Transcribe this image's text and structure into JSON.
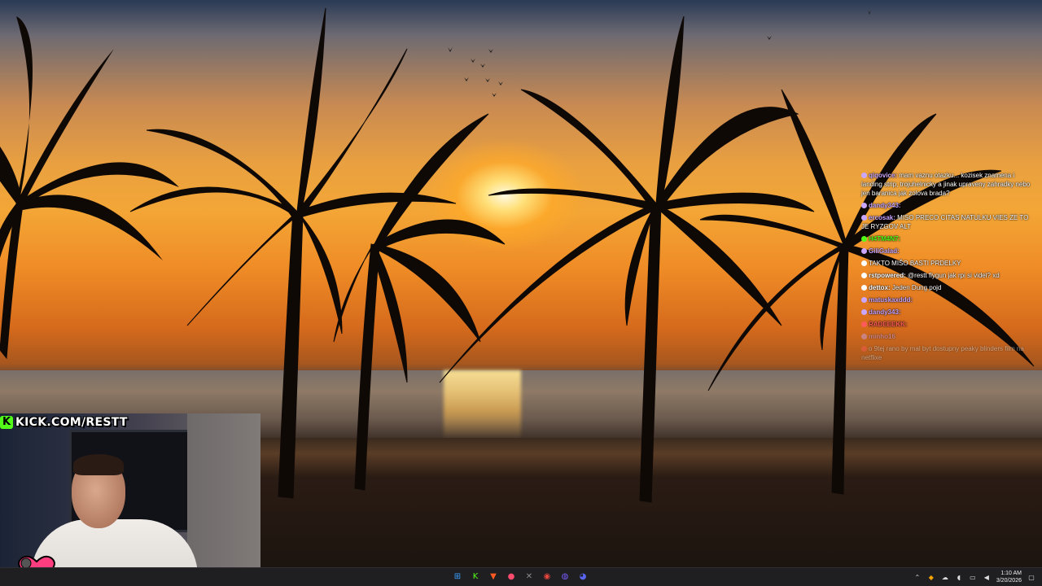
{
  "overlay": {
    "stream_url": "KICK.COM/RESTT",
    "kick_logo_letter": "K"
  },
  "chat": {
    "messages": [
      {
        "user": "qiqovice:",
        "text": "mam vaznu otazku... kozisek znamena i landing strip, trojuhelnicky a jinak upraveny zahradky nebo jen baranica jak zolova brada?",
        "user_color": "#c9a6ff",
        "dim": false
      },
      {
        "user": "dandy343:",
        "text": "",
        "user_color": "#c9a6ff",
        "dim": false
      },
      {
        "user": "ercosak:",
        "text": "MISO PRECO CITAS NATULKU VIES ZE TO JE RYZGOV ALT",
        "user_color": "#c9a6ff",
        "dim": false
      },
      {
        "user": "H4TM4N7:",
        "text": "",
        "user_color": "#53fc18",
        "dim": false
      },
      {
        "user": "GiliGalad:",
        "text": "",
        "user_color": "#c9a6ff",
        "dim": false
      },
      {
        "user": "",
        "text": "TAKTO MIŠO BASTI PRDELKY",
        "user_color": "#ffffff",
        "dim": false
      },
      {
        "user": "rstpowered:",
        "text": "@restt flygun jak rpi si videl? xd",
        "user_color": "#ffffff",
        "dim": false
      },
      {
        "user": "dettox:",
        "text": "Jeden Dung pojd",
        "user_color": "#ffffff",
        "dim": false
      },
      {
        "user": "matuskaxddd:",
        "text": "",
        "user_color": "#c9a6ff",
        "dim": false
      },
      {
        "user": "dandy343:",
        "text": "",
        "user_color": "#c9a6ff",
        "dim": false
      },
      {
        "user": "RADEEEKK:",
        "text": "",
        "user_color": "#ff5a5a",
        "dim": false
      },
      {
        "user": "minho16",
        "text": "",
        "user_color": "#c9a6ff",
        "dim": true
      },
      {
        "user": "",
        "text": "o 9tej rano by mal byt dostupny peaky blinders film na netflixe",
        "user_color": "#ff5a5a",
        "dim": true
      }
    ]
  },
  "taskbar": {
    "apps": [
      {
        "name": "windows-start-icon",
        "glyph": "⊞",
        "color": "#3aa0ff"
      },
      {
        "name": "kick-app-icon",
        "glyph": "K",
        "color": "#53fc18"
      },
      {
        "name": "brave-browser-icon",
        "glyph": "▼",
        "color": "#ff5a1f"
      },
      {
        "name": "pin-app-icon",
        "glyph": "●",
        "color": "#ff4b6e"
      },
      {
        "name": "xbox-app-icon",
        "glyph": "✕",
        "color": "#8a8a8a"
      },
      {
        "name": "chrome-browser-icon",
        "glyph": "◉",
        "color": "#e8453c"
      },
      {
        "name": "obs-app-icon",
        "glyph": "◍",
        "color": "#7a5cff"
      },
      {
        "name": "discord-app-icon",
        "glyph": "◕",
        "color": "#5865f2"
      }
    ],
    "clock": {
      "time": "1:10 AM",
      "date": "3/20/2026"
    }
  }
}
